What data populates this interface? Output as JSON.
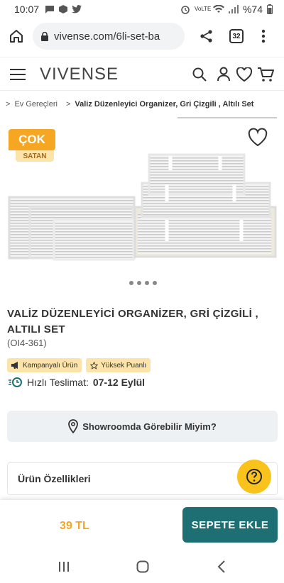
{
  "status_bar": {
    "time": "10:07",
    "network": "VoLTE",
    "battery": "%74"
  },
  "browser": {
    "url": "vivense.com/6li-set-ba",
    "tab_count": "32"
  },
  "site": {
    "logo": "VIVENSE"
  },
  "breadcrumb": {
    "parent": "Ev Gereçleri",
    "current": "Valiz Düzenleyici Organizer, Gri Çizgili , Altılı Set"
  },
  "badge": {
    "top": "ÇOK",
    "bottom": "SATAN"
  },
  "product": {
    "title": "VALİZ DÜZENLEYİCİ ORGANİZER, GRİ ÇİZGİLİ , ALTILI SET",
    "code": "(OI4-361)",
    "tags": [
      {
        "label": "Kampanyalı Ürün"
      },
      {
        "label": "Yüksek Puanlı"
      }
    ],
    "delivery_label": "Hızlı Teslimat:",
    "delivery_value": "07-12 Eylül",
    "image_count": 4
  },
  "showroom_label": "Showroomda Görebilir Miyim?",
  "specs_label": "Ürün Özellikleri",
  "buy": {
    "price": "39 TL",
    "add_label": "SEPETE EKLE"
  },
  "colors": {
    "accent": "#1d6f73",
    "badge": "#f5a623",
    "help": "#fac31b"
  }
}
